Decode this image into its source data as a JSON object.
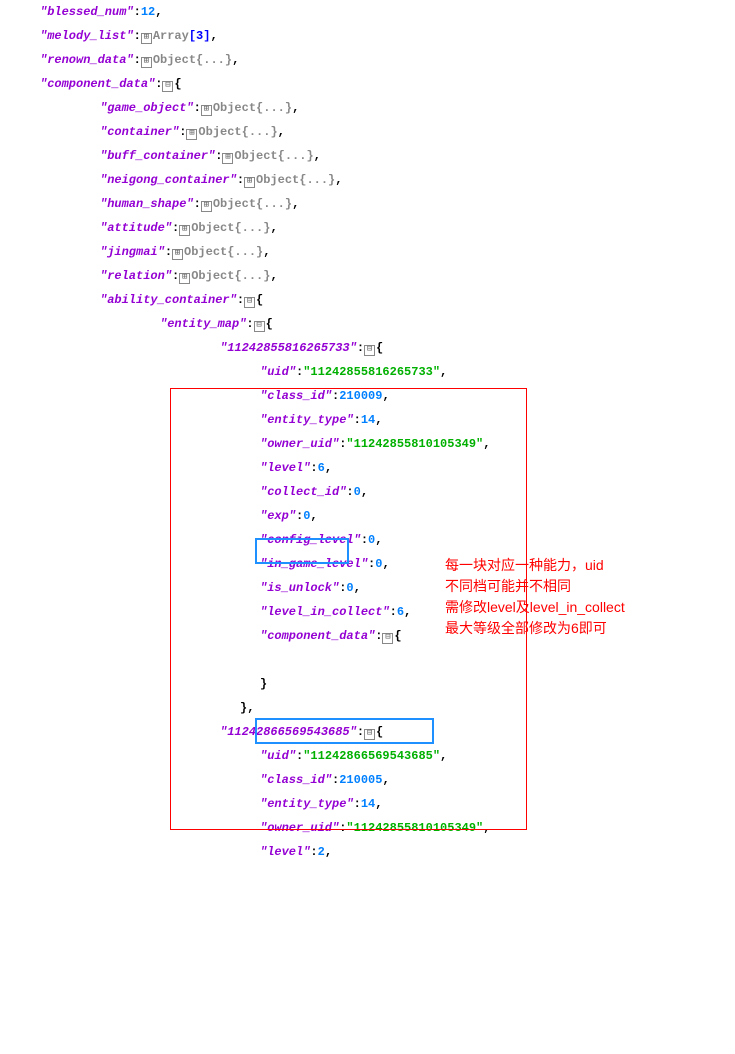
{
  "top": {
    "blessed_num": {
      "key": "\"blessed_num\"",
      "sep": ":",
      "val": "12",
      "comma": ","
    },
    "melody_list": {
      "key": "\"melody_list\"",
      "sep": ":",
      "type": "Array",
      "dim": "[3]",
      "comma": ","
    },
    "renown_data": {
      "key": "\"renown_data\"",
      "sep": ":",
      "type": "Object",
      "dots": "{...}",
      "comma": ","
    },
    "component_data": {
      "key": "\"component_data\"",
      "sep": ":",
      "brace": "{"
    }
  },
  "cd": {
    "game_object": {
      "key": "\"game_object\"",
      "sep": ":",
      "type": "Object",
      "dots": "{...}",
      "comma": ","
    },
    "container": {
      "key": "\"container\"",
      "sep": ":",
      "type": "Object",
      "dots": "{...}",
      "comma": ","
    },
    "buff_container": {
      "key": "\"buff_container\"",
      "sep": ":",
      "type": "Object",
      "dots": "{...}",
      "comma": ","
    },
    "neigong_container": {
      "key": "\"neigong_container\"",
      "sep": ":",
      "type": "Object",
      "dots": "{...}",
      "comma": ","
    },
    "human_shape": {
      "key": "\"human_shape\"",
      "sep": ":",
      "type": "Object",
      "dots": "{...}",
      "comma": ","
    },
    "attitude": {
      "key": "\"attitude\"",
      "sep": ":",
      "type": "Object",
      "dots": "{...}",
      "comma": ","
    },
    "jingmai": {
      "key": "\"jingmai\"",
      "sep": ":",
      "type": "Object",
      "dots": "{...}",
      "comma": ","
    },
    "relation": {
      "key": "\"relation\"",
      "sep": ":",
      "type": "Object",
      "dots": "{...}",
      "comma": ","
    },
    "ability_container": {
      "key": "\"ability_container\"",
      "sep": ":",
      "brace": "{"
    }
  },
  "ac": {
    "entity_map": {
      "key": "\"entity_map\"",
      "sep": ":",
      "brace": "{"
    }
  },
  "e1": {
    "id": {
      "key": "\"11242855816265733\"",
      "sep": ":",
      "brace": "{"
    },
    "uid": {
      "key": "\"uid\"",
      "sep": ":",
      "val": "\"11242855816265733\"",
      "comma": ","
    },
    "class_id": {
      "key": "\"class_id\"",
      "sep": ":",
      "val": "210009",
      "comma": ","
    },
    "entity_type": {
      "key": "\"entity_type\"",
      "sep": ":",
      "val": "14",
      "comma": ","
    },
    "owner_uid": {
      "key": "\"owner_uid\"",
      "sep": ":",
      "val": "\"11242855810105349\"",
      "comma": ","
    },
    "level": {
      "key": "\"level\"",
      "sep": ":",
      "val": "6",
      "comma": ","
    },
    "collect_id": {
      "key": "\"collect_id\"",
      "sep": ":",
      "val": "0",
      "comma": ","
    },
    "exp": {
      "key": "\"exp\"",
      "sep": ":",
      "val": "0",
      "comma": ","
    },
    "config_level": {
      "key": "\"config_level\"",
      "sep": ":",
      "val": "0",
      "comma": ","
    },
    "in_game_level": {
      "key": "\"in_game_level\"",
      "sep": ":",
      "val": "0",
      "comma": ","
    },
    "is_unlock": {
      "key": "\"is_unlock\"",
      "sep": ":",
      "val": "0",
      "comma": ","
    },
    "level_in_collect": {
      "key": "\"level_in_collect\"",
      "sep": ":",
      "val": "6",
      "comma": ","
    },
    "component_data": {
      "key": "\"component_data\"",
      "sep": ":",
      "brace": "{"
    },
    "close1": "}",
    "close2": "},"
  },
  "e2": {
    "id": {
      "key": "\"11242866569543685\"",
      "sep": ":",
      "brace": "{"
    },
    "uid": {
      "key": "\"uid\"",
      "sep": ":",
      "val": "\"11242866569543685\"",
      "comma": ","
    },
    "class_id": {
      "key": "\"class_id\"",
      "sep": ":",
      "val": "210005",
      "comma": ","
    },
    "entity_type": {
      "key": "\"entity_type\"",
      "sep": ":",
      "val": "14",
      "comma": ","
    },
    "owner_uid": {
      "key": "\"owner_uid\"",
      "sep": ":",
      "val": "\"11242855810105349\"",
      "comma": ","
    },
    "level": {
      "key": "\"level\"",
      "sep": ":",
      "val": "2",
      "comma": ","
    }
  },
  "icons": {
    "plus": "⊞",
    "minus": "⊟"
  },
  "annotation": {
    "l1": "每一块对应一种能力，uid",
    "l2": "不同档可能并不相同",
    "l3": "需修改level及level_in_collect",
    "l4": "最大等级全部修改为6即可"
  }
}
